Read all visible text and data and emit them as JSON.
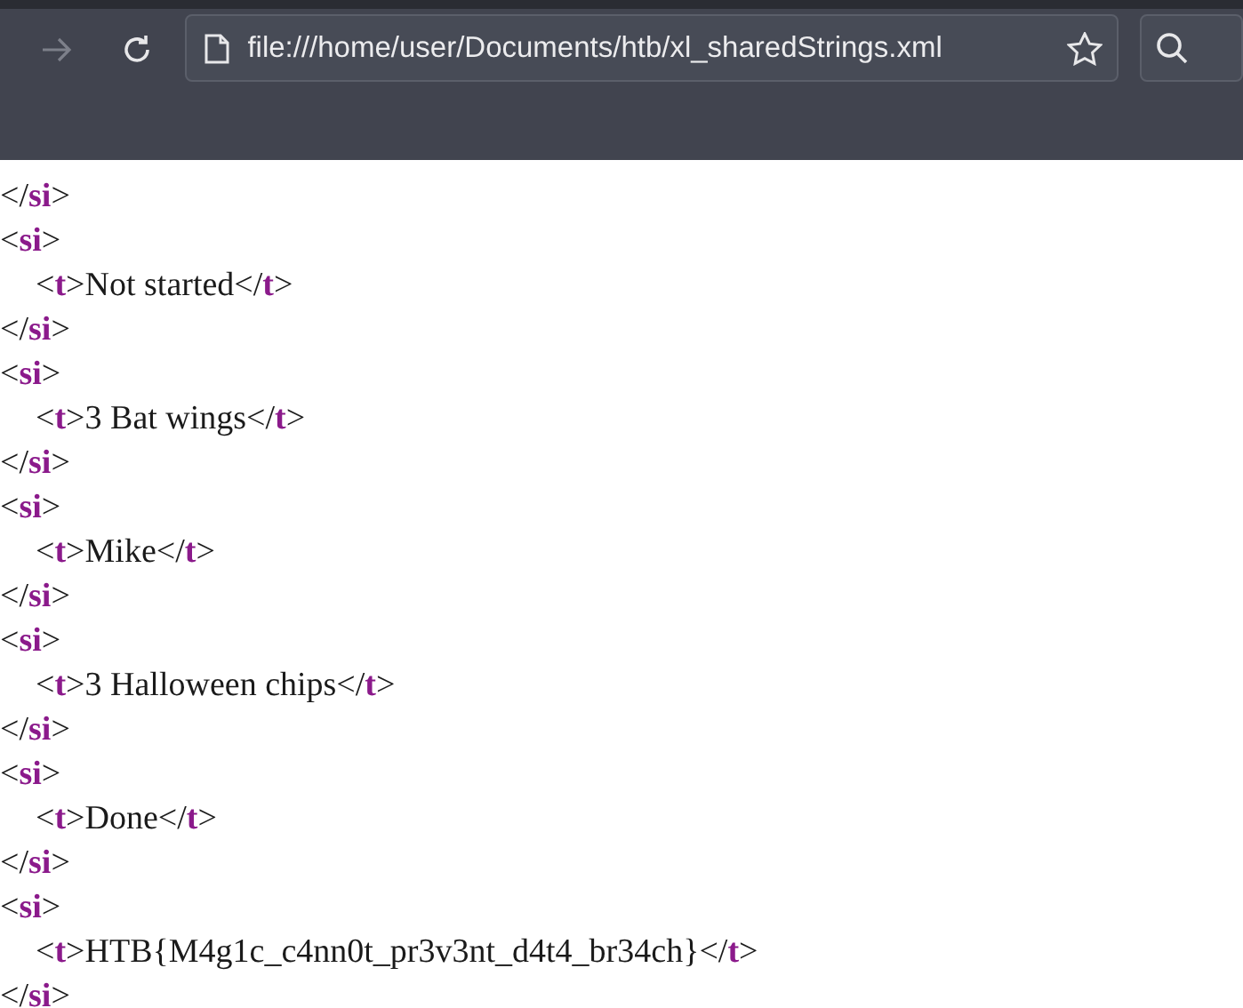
{
  "toolbar": {
    "forward_disabled": true,
    "address": "file:///home/user/Documents/htb/xl_sharedStrings.xml"
  },
  "syntax": {
    "open": "<",
    "close": "</",
    "end": ">"
  },
  "elements": [
    {
      "close": "si"
    },
    {
      "open": "si",
      "children": [
        {
          "open": "t",
          "text": "Not started",
          "close": "t"
        }
      ],
      "close": "si"
    },
    {
      "open": "si",
      "children": [
        {
          "open": "t",
          "text": "3 Bat wings",
          "close": "t"
        }
      ],
      "close": "si"
    },
    {
      "open": "si",
      "children": [
        {
          "open": "t",
          "text": "Mike",
          "close": "t"
        }
      ],
      "close": "si"
    },
    {
      "open": "si",
      "children": [
        {
          "open": "t",
          "text": "3 Halloween chips",
          "close": "t"
        }
      ],
      "close": "si"
    },
    {
      "open": "si",
      "children": [
        {
          "open": "t",
          "text": "Done",
          "close": "t"
        }
      ],
      "close": "si"
    },
    {
      "open": "si",
      "children": [
        {
          "open": "t",
          "text": "HTB{M4g1c_c4nn0t_pr3v3nt_d4t4_br34ch}",
          "close": "t"
        }
      ],
      "close": "si"
    }
  ]
}
